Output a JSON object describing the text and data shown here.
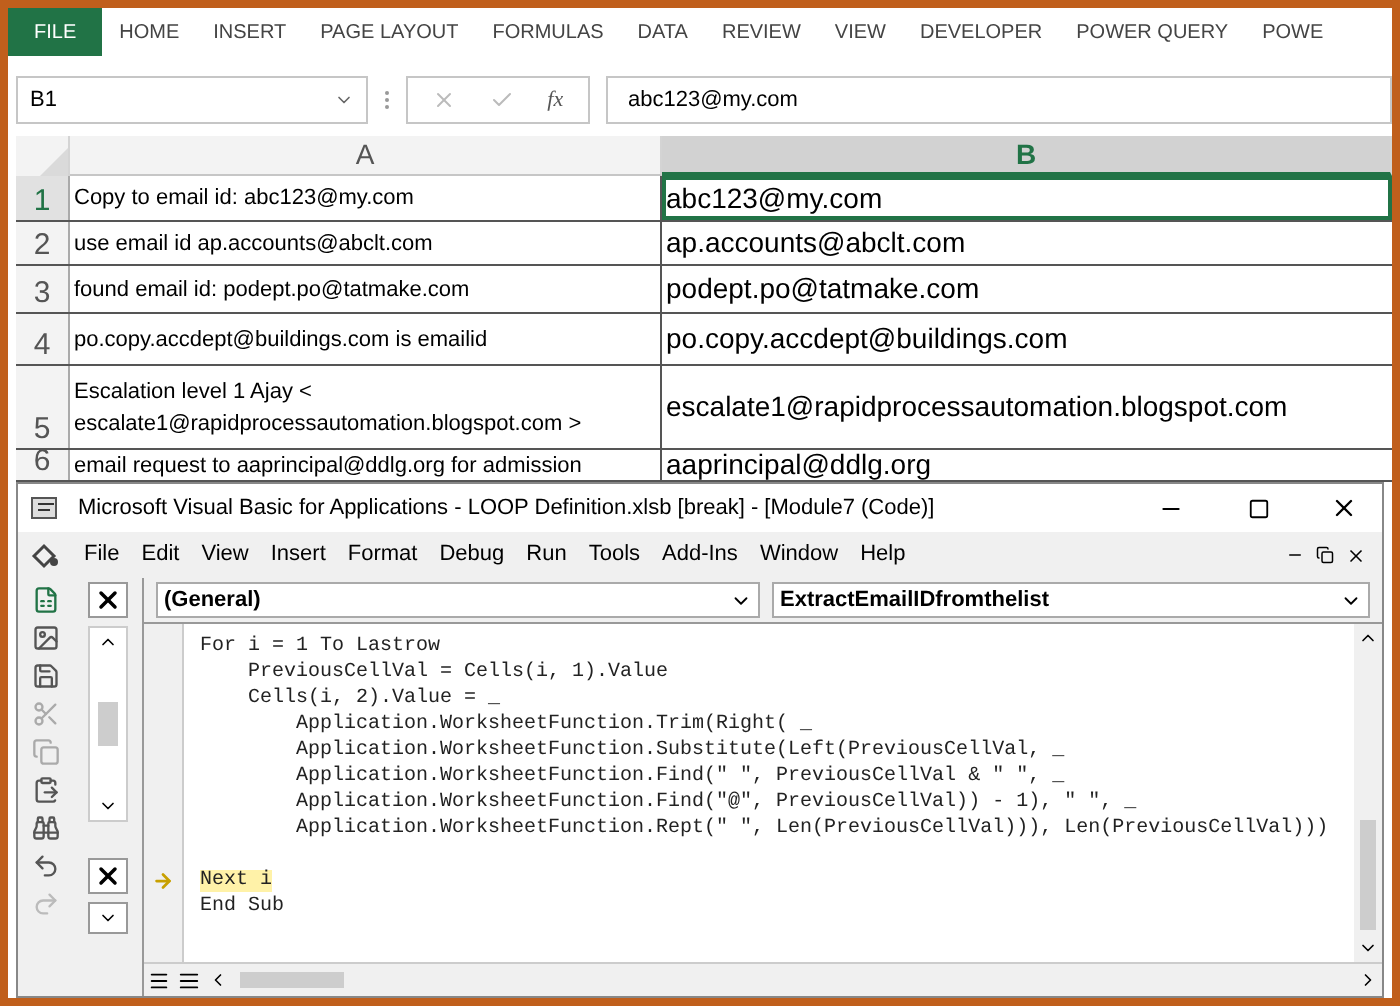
{
  "ribbon": {
    "tabs": [
      {
        "label": "FILE",
        "selected": true
      },
      {
        "label": "HOME",
        "selected": false
      },
      {
        "label": "INSERT",
        "selected": false
      },
      {
        "label": "PAGE LAYOUT",
        "selected": false
      },
      {
        "label": "FORMULAS",
        "selected": false
      },
      {
        "label": "DATA",
        "selected": false
      },
      {
        "label": "REVIEW",
        "selected": false
      },
      {
        "label": "VIEW",
        "selected": false
      },
      {
        "label": "DEVELOPER",
        "selected": false
      },
      {
        "label": "POWER QUERY",
        "selected": false
      },
      {
        "label": "POWE",
        "selected": false
      }
    ]
  },
  "formula_bar": {
    "name_box": "B1",
    "function_label": "fx",
    "value": "abc123@my.com"
  },
  "sheet": {
    "columns": [
      {
        "label": "A",
        "selected": false
      },
      {
        "label": "B",
        "selected": true
      }
    ],
    "rows": [
      {
        "number": "1",
        "selected": true,
        "cells": [
          "Copy to email id: abc123@my.com",
          "abc123@my.com"
        ]
      },
      {
        "number": "2",
        "selected": false,
        "cells": [
          "use email id ap.accounts@abclt.com",
          "ap.accounts@abclt.com"
        ]
      },
      {
        "number": "3",
        "selected": false,
        "cells": [
          "found email id: podept.po@tatmake.com",
          "podept.po@tatmake.com"
        ]
      },
      {
        "number": "4",
        "selected": false,
        "cells": [
          "po.copy.accdept@buildings.com is emailid",
          "po.copy.accdept@buildings.com"
        ]
      },
      {
        "number": "5",
        "selected": false,
        "cells": [
          "Escalation level 1 Ajay  < escalate1@rapidprocessautomation.blogspot.com >",
          "escalate1@rapidprocessautomation.blogspot.com"
        ]
      },
      {
        "number": "6",
        "selected": false,
        "cells": [
          "email request to aaprincipal@ddlg.org for admission",
          "aaprincipal@ddlg.org"
        ]
      }
    ]
  },
  "vba_window": {
    "title": "Microsoft Visual Basic for Applications - LOOP Definition.xlsb [break] - [Module7 (Code)]",
    "menu": [
      "File",
      "Edit",
      "View",
      "Insert",
      "Format",
      "Debug",
      "Run",
      "Tools",
      "Add-Ins",
      "Window",
      "Help"
    ],
    "object_dropdown": "(General)",
    "procedure_dropdown": "ExtractEmailIDfromthelist",
    "code_lines": [
      {
        "text": "For i = 1 To Lastrow",
        "current": false
      },
      {
        "text": "    PreviousCellVal = Cells(i, 1).Value",
        "current": false
      },
      {
        "text": "    Cells(i, 2).Value = _",
        "current": false
      },
      {
        "text": "        Application.WorksheetFunction.Trim(Right( _",
        "current": false
      },
      {
        "text": "        Application.WorksheetFunction.Substitute(Left(PreviousCellVal, _",
        "current": false
      },
      {
        "text": "        Application.WorksheetFunction.Find(\" \", PreviousCellVal & \" \", _",
        "current": false
      },
      {
        "text": "        Application.WorksheetFunction.Find(\"@\", PreviousCellVal)) - 1), \" \", _",
        "current": false
      },
      {
        "text": "        Application.WorksheetFunction.Rept(\" \", Len(PreviousCellVal))), Len(PreviousCellVal)))",
        "current": false
      },
      {
        "kind": "blank"
      },
      {
        "text": "Next i",
        "current": true
      },
      {
        "text": "End Sub",
        "current": false
      }
    ]
  }
}
